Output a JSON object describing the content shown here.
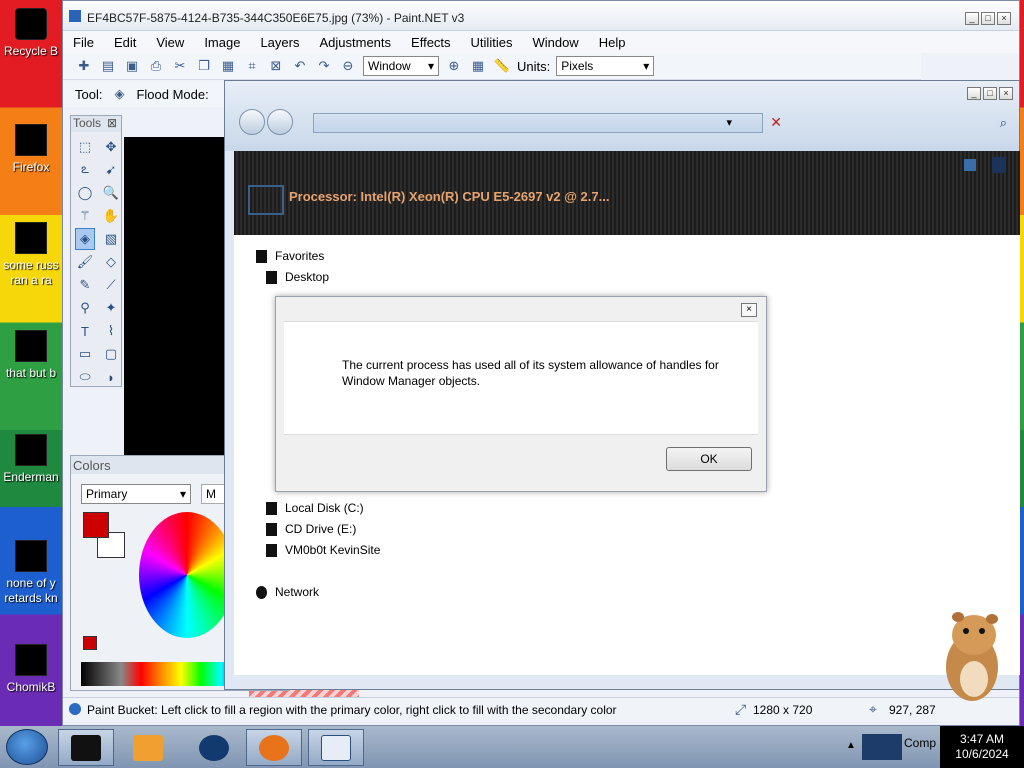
{
  "desktop": {
    "icons": [
      {
        "label": "Recycle B"
      },
      {
        "label": "Firefox"
      },
      {
        "label": "some russ"
      },
      {
        "label": "ran a ra"
      },
      {
        "label": "that but b"
      },
      {
        "label": "Enderman"
      },
      {
        "label": "none of y"
      },
      {
        "label": "retards kn"
      },
      {
        "label": "ChomikB"
      }
    ]
  },
  "paintnet": {
    "title": "EF4BC57F-5875-4124-B735-344C350E6E75.jpg (73%) - Paint.NET v3",
    "menu": [
      "File",
      "Edit",
      "View",
      "Image",
      "Layers",
      "Adjustments",
      "Effects",
      "Utilities",
      "Window",
      "Help"
    ],
    "zoom_select": "Window",
    "units_label": "Units:",
    "units_select": "Pixels",
    "tool_label": "Tool:",
    "flood_label": "Flood Mode:",
    "tools_title": "Tools",
    "colors_title": "Colors",
    "colors_mode": "Primary",
    "colors_more": "M",
    "status_text": "Paint Bucket: Left click to fill a region with the primary color, right click to fill with the secondary color",
    "image_size": "1280 x 720",
    "cursor_pos": "927, 287",
    "primary_color": "#cc0000",
    "secondary_color": "#ffffff"
  },
  "explorer": {
    "banner_text": "Processor: Intel(R) Xeon(R) CPU E5-2697 v2 @ 2.7...",
    "favorites": "Favorites",
    "desktop": "Desktop",
    "drives": [
      "Local Disk (C:)",
      "CD Drive (E:)",
      "VM0b0t KevinSite"
    ],
    "network": "Network"
  },
  "dialog": {
    "message": "The current process has used all of its system allowance of handles for Window Manager objects.",
    "ok_label": "OK",
    "close_label": "×"
  },
  "taskbar": {
    "clock_time": "3:47 AM",
    "clock_date": "10/6/2024",
    "tray_label": "Comp"
  }
}
